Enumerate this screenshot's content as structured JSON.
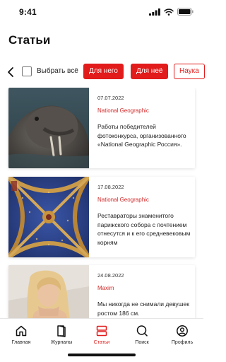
{
  "status": {
    "time": "9:41"
  },
  "page": {
    "title": "Статьи"
  },
  "filters": {
    "select_all_label": "Выбрать всё",
    "chips": [
      {
        "label": "Для него",
        "active": true
      },
      {
        "label": "Для неё",
        "active": true
      },
      {
        "label": "Наука",
        "active": false
      }
    ]
  },
  "articles": [
    {
      "date": "07.07.2022",
      "source": "National Geographic",
      "text": "Работы победителей фотоконкурса, организованного «National Geographic Россия»."
    },
    {
      "date": "17.08.2022",
      "source": "National Geographic",
      "text": "Реставраторы знаменитого парижского собора с почтением отнесутся и к его средневековым корням"
    },
    {
      "date": "24.08.2022",
      "source": "Maxim",
      "text": "Мы никогда не снимали девушек ростом 186 см."
    }
  ],
  "tabs": [
    {
      "label": "Главная",
      "icon": "home-icon",
      "active": false
    },
    {
      "label": "Журналы",
      "icon": "magazine-icon",
      "active": false
    },
    {
      "label": "Статьи",
      "icon": "articles-icon",
      "active": true
    },
    {
      "label": "Поиск",
      "icon": "search-icon",
      "active": false
    },
    {
      "label": "Профиль",
      "icon": "profile-icon",
      "active": false
    }
  ],
  "colors": {
    "accent": "#e21b1b"
  }
}
